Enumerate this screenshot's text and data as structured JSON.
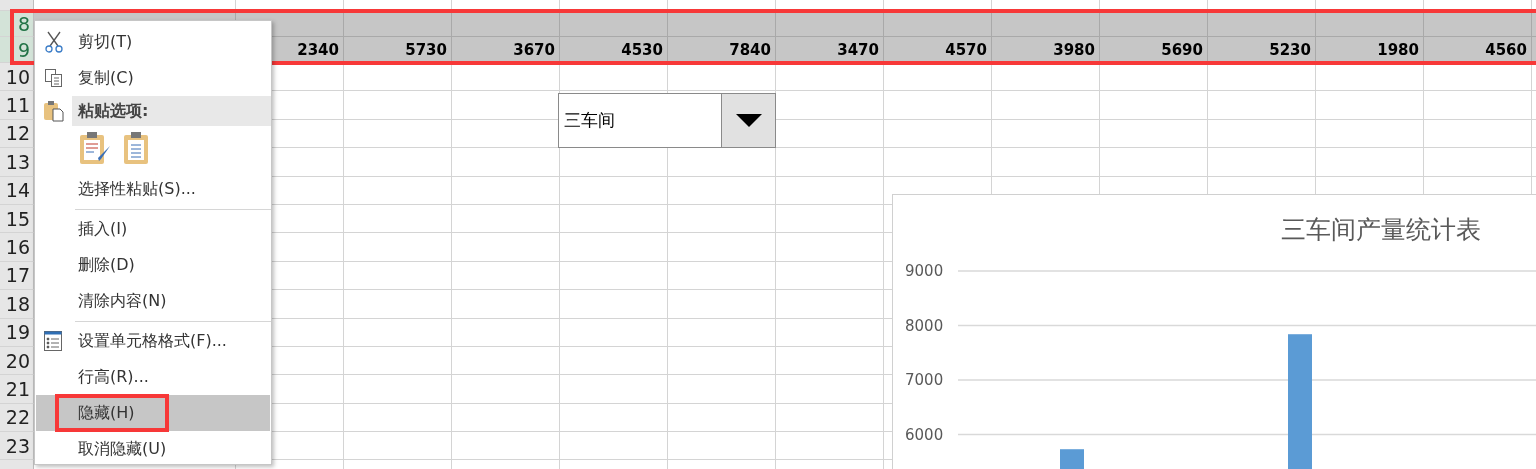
{
  "sheet": {
    "rows": [
      {
        "number": "8",
        "selected": true
      },
      {
        "number": "9",
        "selected": true,
        "cells": [
          "",
          "2340",
          "5730",
          "3670",
          "4530",
          "7840",
          "3470",
          "4570",
          "3980",
          "5690",
          "5230",
          "1980",
          "4560"
        ]
      },
      {
        "number": "10",
        "selected": false
      },
      {
        "number": "11",
        "selected": false
      },
      {
        "number": "12",
        "selected": false
      },
      {
        "number": "13",
        "selected": false
      },
      {
        "number": "14",
        "selected": false
      },
      {
        "number": "15",
        "selected": false
      },
      {
        "number": "16",
        "selected": false
      },
      {
        "number": "17",
        "selected": false
      },
      {
        "number": "18",
        "selected": false
      },
      {
        "number": "19",
        "selected": false
      },
      {
        "number": "20",
        "selected": false
      },
      {
        "number": "21",
        "selected": false
      },
      {
        "number": "22",
        "selected": false
      },
      {
        "number": "23",
        "selected": false
      }
    ]
  },
  "dropdown": {
    "value": "三车间"
  },
  "chart": {
    "chart_data": {
      "type": "bar",
      "title": "三车间产量统计表",
      "values": [
        null,
        5730,
        null,
        null,
        7840,
        null,
        null,
        null
      ],
      "ylim": [
        0,
        9000
      ],
      "grid": true,
      "yticks": [
        6000,
        7000,
        8000,
        9000
      ]
    }
  },
  "context_menu": {
    "items": [
      {
        "kind": "command",
        "label": "剪切(T)",
        "selected": false
      },
      {
        "kind": "command",
        "label": "复制(C)",
        "selected": false
      },
      {
        "kind": "header",
        "label": "粘贴选项:"
      },
      {
        "kind": "paste-options"
      },
      {
        "kind": "command",
        "label": "选择性粘贴(S)...",
        "selected": false
      },
      {
        "kind": "divider"
      },
      {
        "kind": "command",
        "label": "插入(I)",
        "selected": false
      },
      {
        "kind": "command",
        "label": "删除(D)",
        "selected": false
      },
      {
        "kind": "command",
        "label": "清除内容(N)",
        "selected": false
      },
      {
        "kind": "divider"
      },
      {
        "kind": "command",
        "label": "设置单元格格式(F)...",
        "selected": false
      },
      {
        "kind": "command",
        "label": "行高(R)...",
        "selected": false
      },
      {
        "kind": "command",
        "label": "隐藏(H)",
        "selected": true
      },
      {
        "kind": "command",
        "label": "取消隐藏(U)",
        "selected": false
      }
    ]
  }
}
